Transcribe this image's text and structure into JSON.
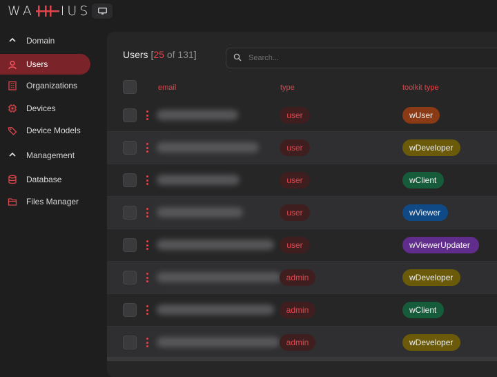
{
  "app": {
    "logo_text_left": "WA",
    "logo_mark": "-H-",
    "logo_text_right": "IUS",
    "monitor_icon": "monitor-icon"
  },
  "sidebar": {
    "domain_label": "Domain",
    "management_label": "Management",
    "domain_items": [
      {
        "label": "Users",
        "icon": "user-icon",
        "active": true
      },
      {
        "label": "Organizations",
        "icon": "building-icon"
      },
      {
        "label": "Devices",
        "icon": "chip-icon"
      },
      {
        "label": "Device Models",
        "icon": "tag-icon"
      }
    ],
    "management_items": [
      {
        "label": "Database",
        "icon": "database-icon"
      },
      {
        "label": "Files Manager",
        "icon": "folder-icon"
      }
    ]
  },
  "users": {
    "title": "Users",
    "shown": "25",
    "of_word": "of",
    "total": "131",
    "search_placeholder": "Search..."
  },
  "table": {
    "headers": {
      "email": "email",
      "type": "type",
      "toolkit": "toolkit type"
    },
    "rows": [
      {
        "type": "user",
        "toolkit": "wUser",
        "toolkit_color": "#8a3a14"
      },
      {
        "type": "user",
        "toolkit": "wDeveloper",
        "toolkit_color": "#6a5a0a"
      },
      {
        "type": "user",
        "toolkit": "wClient",
        "toolkit_color": "#175c3a"
      },
      {
        "type": "user",
        "toolkit": "wViewer",
        "toolkit_color": "#0f4a87"
      },
      {
        "type": "user",
        "toolkit": "wViewerUpdater",
        "toolkit_color": "#612d8c"
      },
      {
        "type": "admin",
        "toolkit": "wDeveloper",
        "toolkit_color": "#6a5a0a"
      },
      {
        "type": "admin",
        "toolkit": "wClient",
        "toolkit_color": "#175c3a"
      },
      {
        "type": "admin",
        "toolkit": "wDeveloper",
        "toolkit_color": "#6a5a0a"
      }
    ]
  },
  "colors": {
    "accent": "#e0454b",
    "active_nav": "#7a2329"
  }
}
